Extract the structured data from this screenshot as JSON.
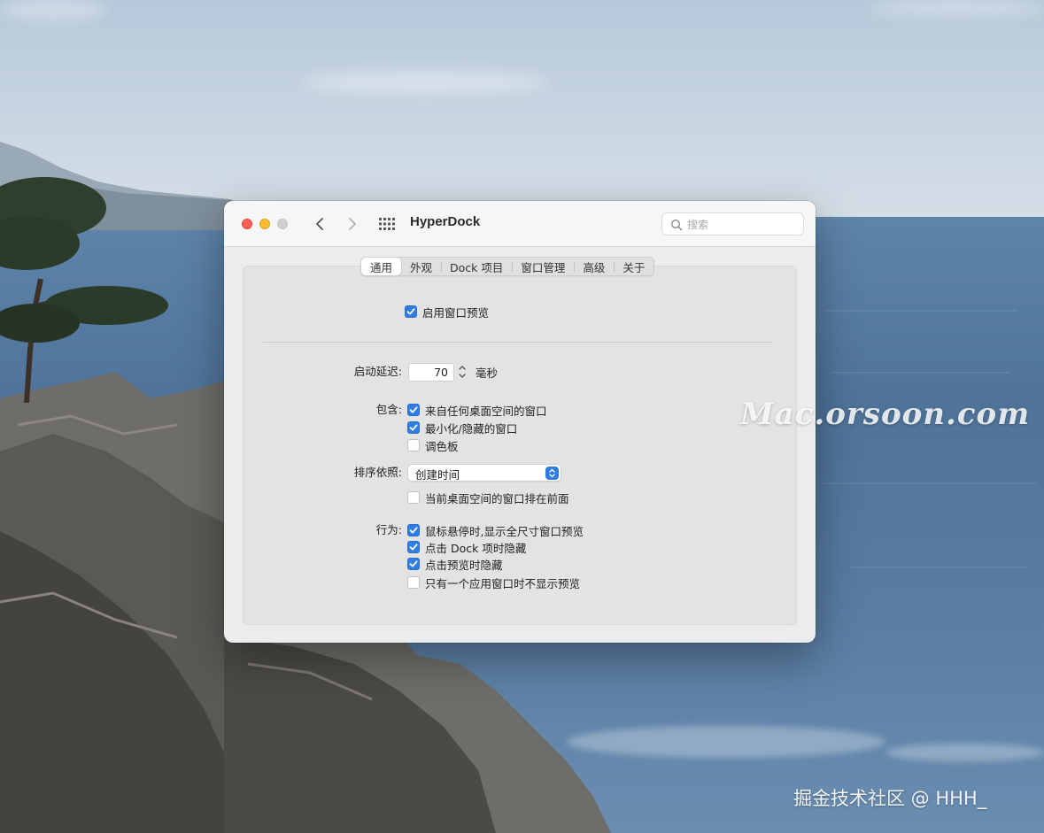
{
  "window": {
    "title": "HyperDock",
    "search_placeholder": "搜索"
  },
  "tabs": [
    {
      "label": "通用",
      "active": true
    },
    {
      "label": "外观",
      "active": false
    },
    {
      "label": "Dock 项目",
      "active": false
    },
    {
      "label": "窗口管理",
      "active": false
    },
    {
      "label": "高级",
      "active": false
    },
    {
      "label": "关于",
      "active": false
    }
  ],
  "general": {
    "enable_preview": {
      "label": "启用窗口预览",
      "checked": true
    },
    "delay": {
      "label": "启动延迟:",
      "value": "70",
      "unit": "毫秒"
    },
    "include": {
      "label": "包含:",
      "options": [
        {
          "label": "来自任何桌面空间的窗口",
          "checked": true
        },
        {
          "label": "最小化/隐藏的窗口",
          "checked": true
        },
        {
          "label": "调色板",
          "checked": false
        }
      ]
    },
    "sort": {
      "label": "排序依照:",
      "value": "创建时间",
      "option": {
        "label": "当前桌面空间的窗口排在前面",
        "checked": false
      }
    },
    "behavior": {
      "label": "行为:",
      "options": [
        {
          "label": "鼠标悬停时,显示全尺寸窗口预览",
          "checked": true
        },
        {
          "label": "点击 Dock 项时隐藏",
          "checked": true
        },
        {
          "label": "点击预览时隐藏",
          "checked": true
        },
        {
          "label": "只有一个应用窗口时不显示预览",
          "checked": false
        }
      ]
    }
  },
  "overlay": {
    "watermark": "Mac.orsoon.com",
    "credit": "掘金技术社区 @ HHH_"
  },
  "colors": {
    "accent": "#2f7de1",
    "close": "#ff5f57",
    "minimize": "#febc2e",
    "zoom_disabled": "#d0d0d0"
  }
}
